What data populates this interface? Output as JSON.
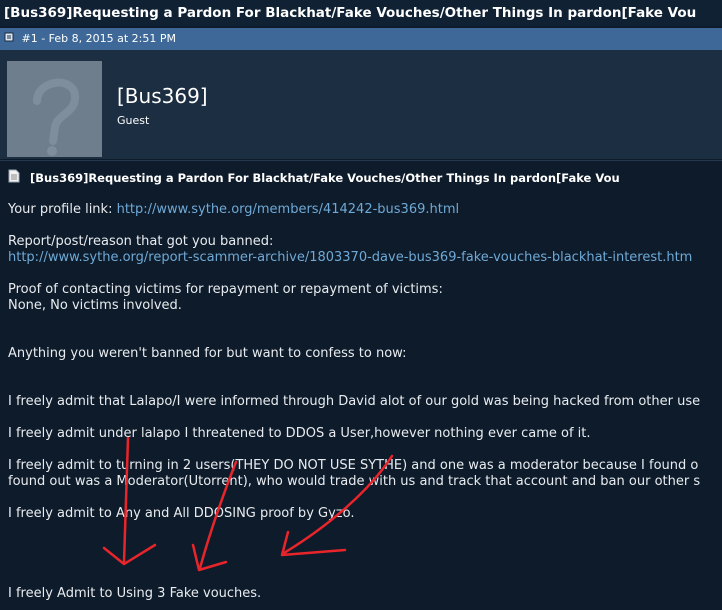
{
  "thread": {
    "title": "[Bus369]Requesting a Pardon For Blackhat/Fake Vouches/Other Things In pardon[Fake Vou"
  },
  "post": {
    "meta": "#1 - Feb 8, 2015 at 2:51 PM",
    "meta_icon": "post-page-icon",
    "title": "[Bus369]Requesting a Pardon For Blackhat/Fake Vouches/Other Things In pardon[Fake Vou",
    "title_icon": "document-icon"
  },
  "user": {
    "name": "[Bus369]",
    "title": "Guest",
    "avatar_icon": "question-mark-avatar-icon"
  },
  "body": {
    "profile_label": "Your profile link: ",
    "profile_url": "http://www.sythe.org/members/414242-bus369.html",
    "report_label": "Report/post/reason that got you banned:",
    "report_url": "http://www.sythe.org/report-scammer-archive/1803370-dave-bus369-fake-vouches-blackhat-interest.htm",
    "proof_label": "Proof of contacting victims for repayment or repayment of victims:",
    "proof_value": "None, No victims involved.",
    "confess_label": "Anything you weren't banned for but want to confess to now:",
    "admit1": "I freely admit that Lalapo/I were informed through David alot of our gold was being hacked from other use",
    "admit2": "I freely admit under lalapo I threatened to DDOS a User,however nothing ever came of it.",
    "admit3a": "I freely admit to turning in 2 users(THEY DO NOT USE SYTHE) and one was a moderator because I found o",
    "admit3b": "found out was a Moderator(Utorrent), who would trade with us and track that account and ban our other s",
    "admit4": "I freely admit to Any and All DDOSING proof by Gyzo.",
    "admit5": "I freely Admit to Using 3 Fake vouches."
  },
  "annotation": {
    "arrow_color": "#e8252b",
    "arrow_count": 3,
    "description": "hand-drawn red arrows"
  }
}
